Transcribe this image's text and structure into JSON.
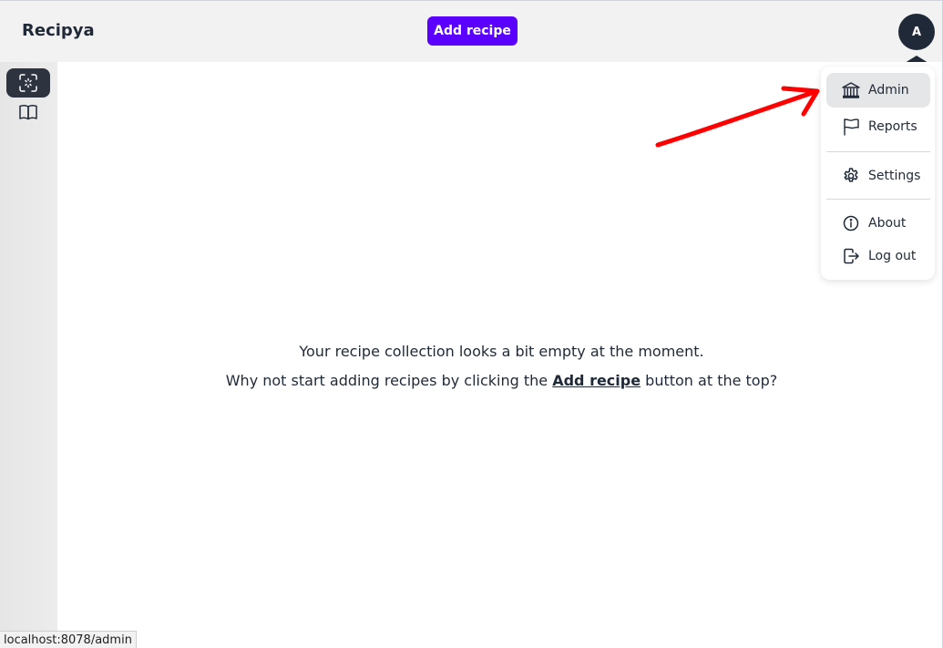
{
  "header": {
    "brand": "Recipya",
    "add_recipe_label": "Add recipe",
    "avatar_initial": "A"
  },
  "sidebar": {
    "items": [
      {
        "icon": "scan-icon",
        "active": true
      },
      {
        "icon": "book-icon",
        "active": false
      }
    ]
  },
  "main": {
    "empty_line1": "Your recipe collection looks a bit empty at the moment.",
    "empty_line2_before": "Why not start adding recipes by clicking the ",
    "empty_line2_link": "Add recipe",
    "empty_line2_after": " button at the top?"
  },
  "user_menu": {
    "items": [
      {
        "label": "Admin",
        "icon": "bank-icon",
        "highlighted": true
      },
      {
        "label": "Reports",
        "icon": "flag-icon"
      },
      {
        "label": "Settings",
        "icon": "gear-icon"
      },
      {
        "label": "About",
        "icon": "info-icon"
      },
      {
        "label": "Log out",
        "icon": "logout-icon"
      }
    ]
  },
  "status_bar": {
    "url": "localhost:8078/admin"
  },
  "colors": {
    "accent": "#5b00ff",
    "dark": "#1f2937",
    "annotation_arrow": "#ff0000"
  }
}
